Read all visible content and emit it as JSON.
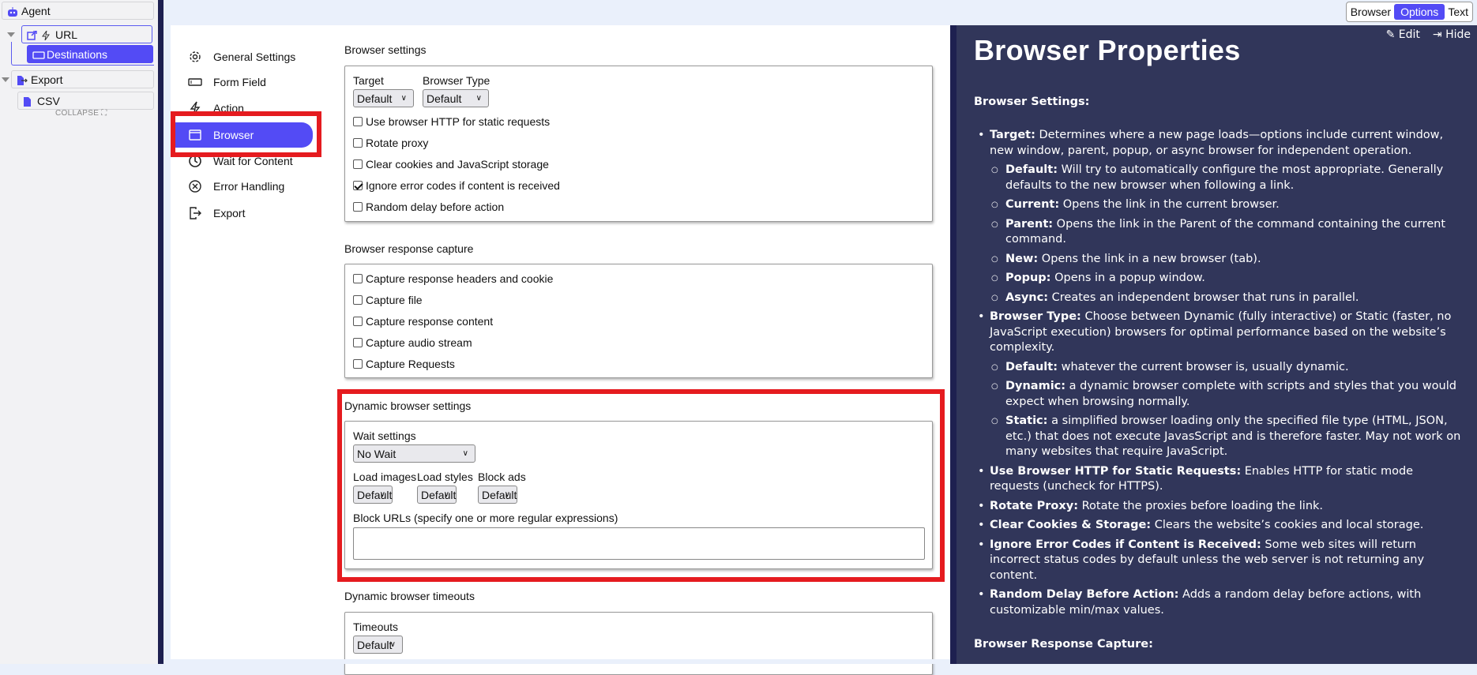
{
  "tree": {
    "agent": "Agent",
    "url": "URL",
    "destinations": "Destinations",
    "export": "Export",
    "csv": "CSV",
    "collapse": "COLLAPSE"
  },
  "nav": [
    {
      "label": "General Settings",
      "icon": "gear-icon"
    },
    {
      "label": "Form Field",
      "icon": "form-field-icon"
    },
    {
      "label": "Action",
      "icon": "lightning-icon"
    },
    {
      "label": "Browser",
      "icon": "browser-window-icon",
      "active": true
    },
    {
      "label": "Wait for Content",
      "icon": "clock-icon"
    },
    {
      "label": "Error Handling",
      "icon": "circle-x-icon"
    },
    {
      "label": "Export",
      "icon": "export-icon"
    }
  ],
  "view_tabs": [
    "Browser",
    "Options",
    "Text"
  ],
  "active_view_tab": "Options",
  "form": {
    "browser_settings": {
      "title": "Browser settings",
      "target_label": "Target",
      "target_value": "Default",
      "browser_type_label": "Browser Type",
      "browser_type_value": "Default",
      "checkboxes": [
        {
          "label": "Use browser HTTP for static requests",
          "checked": false
        },
        {
          "label": "Rotate proxy",
          "checked": false
        },
        {
          "label": "Clear cookies and JavaScript storage",
          "checked": false
        },
        {
          "label": "Ignore error codes if content is received",
          "checked": true
        },
        {
          "label": "Random delay before action",
          "checked": false
        }
      ]
    },
    "response_capture": {
      "title": "Browser response capture",
      "checkboxes": [
        {
          "label": "Capture response headers and cookie",
          "checked": false
        },
        {
          "label": "Capture file",
          "checked": false
        },
        {
          "label": "Capture response content",
          "checked": false
        },
        {
          "label": "Capture audio stream",
          "checked": false
        },
        {
          "label": "Capture Requests",
          "checked": false
        }
      ]
    },
    "dynamic": {
      "title": "Dynamic browser settings",
      "wait_label": "Wait settings",
      "wait_value": "No Wait",
      "load_images_label": "Load images",
      "load_images_value": "Default",
      "load_styles_label": "Load styles",
      "load_styles_value": "Default",
      "block_ads_label": "Block ads",
      "block_ads_value": "Default",
      "block_urls_label": "Block URLs (specify one or more regular expressions)",
      "block_urls_value": ""
    },
    "timeouts": {
      "title": "Dynamic browser timeouts",
      "label": "Timeouts",
      "value": "Default"
    }
  },
  "help": {
    "edit": "Edit",
    "hide": "Hide",
    "title": "Browser Properties",
    "section1": "Browser Settings:",
    "items": [
      {
        "term": "Target:",
        "text": "  Determines where a new page loads—options include current window, new window, parent, popup, or async browser for independent operation.",
        "sub": [
          {
            "term": "Default:",
            "text": " Will try to automatically configure the most appropriate. Generally defaults to the new browser when following a link."
          },
          {
            "term": "Current:",
            "text": " Opens the link in the current browser."
          },
          {
            "term": "Parent:",
            "text": " Opens the link in the Parent of the command containing the current command."
          },
          {
            "term": "New:",
            "text": " Opens the link in a new browser (tab)."
          },
          {
            "term": "Popup:",
            "text": " Opens in a popup window."
          },
          {
            "term": "Async:",
            "text": " Creates an independent browser that runs in parallel."
          }
        ]
      },
      {
        "term": "Browser Type:",
        "text": " Choose between Dynamic (fully interactive) or Static (faster, no JavaScript execution) browsers for optimal performance based on the website’s complexity.",
        "sub": [
          {
            "term": "Default:",
            "text": " whatever the current browser is, usually dynamic."
          },
          {
            "term": "Dynamic:",
            "text": " a dynamic browser complete with scripts and styles that you would expect when browsing normally."
          },
          {
            "term": "Static:",
            "text": " a simplified browser loading only the specified file type (HTML, JSON, etc.) that does not execute JavasScript and is therefore faster.  May not work on many websites that require JavaScript."
          }
        ]
      },
      {
        "term": "Use Browser HTTP for Static Requests:",
        "text": " Enables HTTP for static mode requests (uncheck for HTTPS)."
      },
      {
        "term": "Rotate Proxy:",
        "text": " Rotate the proxies before loading the link."
      },
      {
        "term": "Clear Cookies & Storage:",
        "text": " Clears the website’s cookies and local storage."
      },
      {
        "term": "Ignore Error Codes if Content is Received:",
        "text": " Some web sites will return incorrect status codes by default unless the web server is not returning any content."
      },
      {
        "term": "Random Delay Before Action:",
        "text": " Adds a random delay before actions, with customizable min/max values."
      }
    ],
    "section2": "Browser Response Capture:"
  },
  "colors": {
    "accent": "#534bf5",
    "help_bg": "#31365a",
    "divider": "#1e2050",
    "highlight": "#e51b1f"
  }
}
